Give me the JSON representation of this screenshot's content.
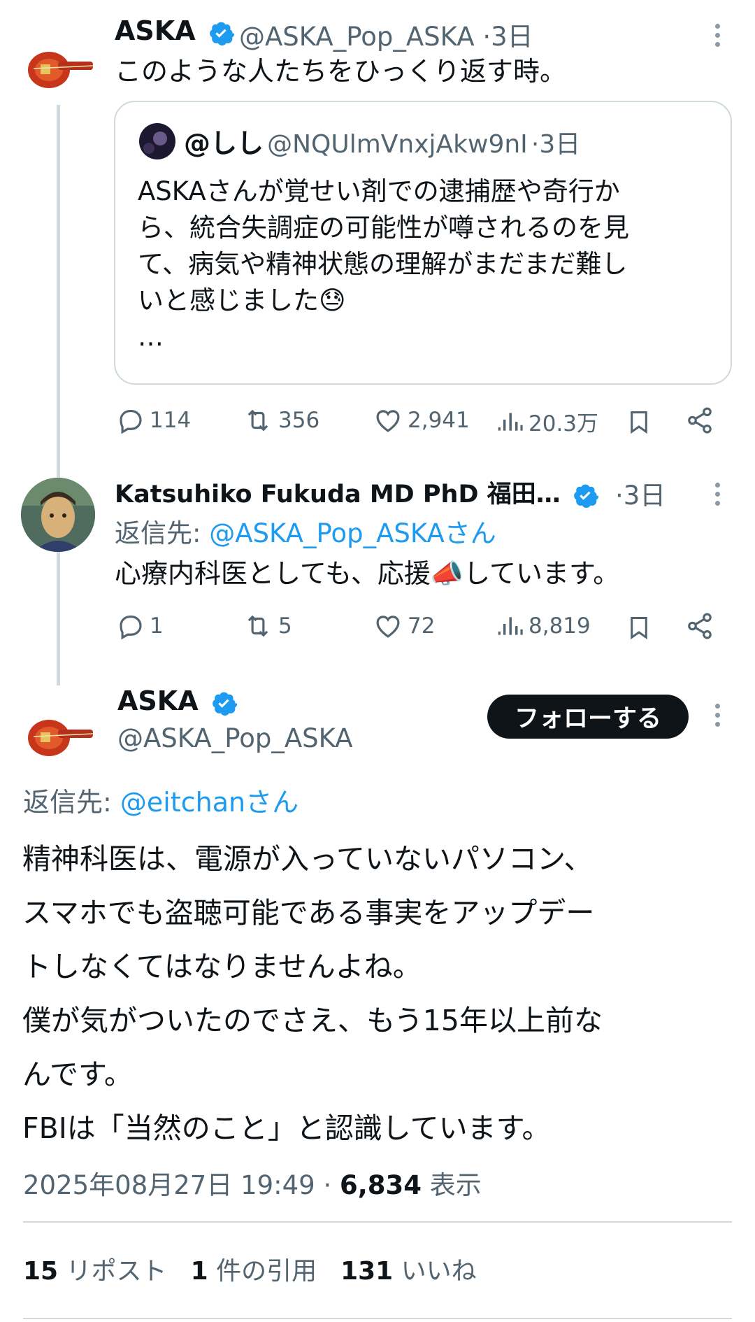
{
  "tweet1": {
    "name": "ASKA",
    "handle": "@ASKA_Pop_ASKA",
    "sep": "·",
    "time": "3日",
    "text": "このような人たちをひっくり返す時。",
    "quote": {
      "name": "@しし",
      "handle": "@NQUlmVnxjAkw9nI",
      "sep": "·",
      "time": "3日",
      "lines": [
        "ASKAさんが覚せい剤での逮捕歴や奇行か",
        "ら、統合失調症の可能性が噂されるのを見",
        "て、病気や精神状態の理解がまだまだ難し",
        "いと感じました😓"
      ],
      "ellipsis": "…"
    },
    "actions": {
      "replies": "114",
      "reposts": "356",
      "likes": "2,941",
      "views": "20.3万"
    }
  },
  "tweet2": {
    "name": "Katsuhiko Fukuda MD PhD 福田…",
    "sep": "·",
    "time": "3日",
    "reply_prefix": "返信先: ",
    "reply_to": "@ASKA_Pop_ASKAさん",
    "text": "心療内科医としても、応援📣しています。",
    "actions": {
      "replies": "1",
      "reposts": "5",
      "likes": "72",
      "views": "8,819"
    }
  },
  "main": {
    "name": "ASKA",
    "handle": "@ASKA_Pop_ASKA",
    "follow_label": "フォローする",
    "reply_prefix": "返信先: ",
    "reply_to": "@eitchanさん",
    "lines": [
      "精神科医は、電源が入っていないパソコン、",
      "スマホでも盗聴可能である事実をアップデー",
      "トしなくてはなりませんよね。",
      "僕が気がついたのでさえ、もう15年以上前な",
      "んです。",
      "FBIは「当然のこと」と認識しています。"
    ],
    "timestamp": "2025年08月27日 19:49 · ",
    "views_count": "6,834",
    "views_label": " 表示",
    "stats": {
      "reposts_count": "15",
      "reposts_label": " リポスト",
      "quotes_count": "1",
      "quotes_label": " 件の引用",
      "likes_count": "131",
      "likes_label": " いいね"
    }
  },
  "colors": {
    "accent": "#1d9bf0",
    "text": "#0f1419",
    "muted": "#536471",
    "border": "#cfd9de"
  }
}
